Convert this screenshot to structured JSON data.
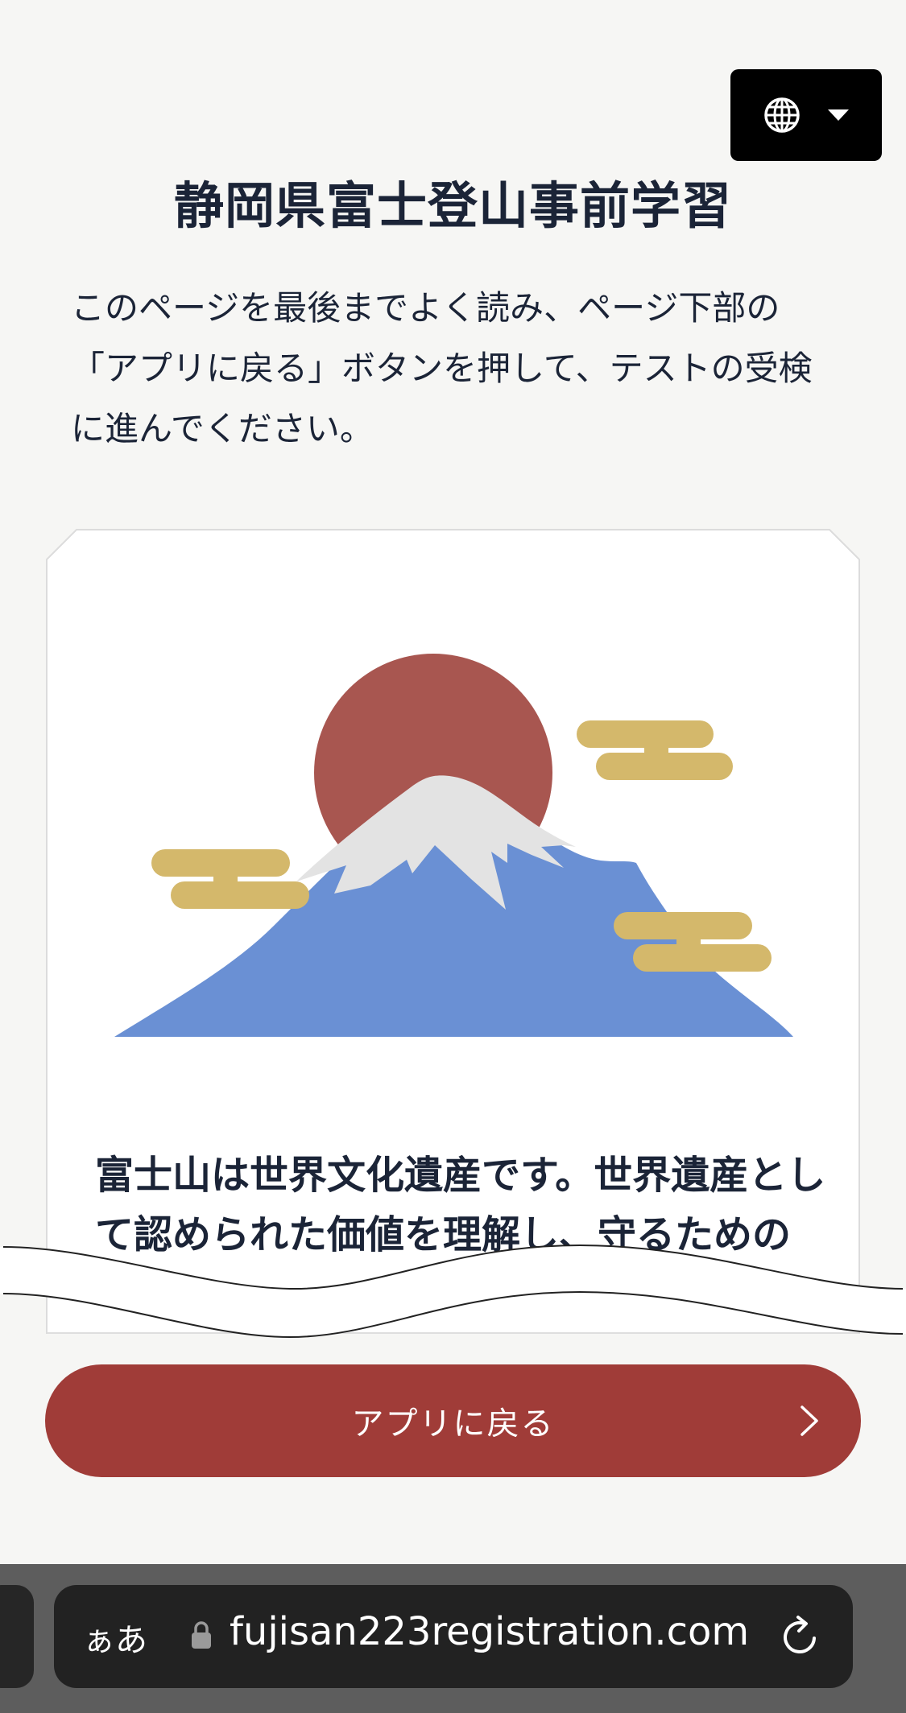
{
  "language_button": {
    "icon": "globe-icon",
    "dropdown_icon": "caret-down-icon"
  },
  "page": {
    "title": "静岡県富士登山事前学習",
    "intro": "このページを最後までよく読み、ページ下部の「アプリに戻る」ボタンを押して、テストの受検に進んでください。"
  },
  "card": {
    "illustration": "mount-fuji-sunrise-illustration",
    "text": "富士山は世界文化遺産です。世界遺産として認められた価値を理解し、守るための"
  },
  "return_button": {
    "label": "アプリに戻る",
    "icon": "chevron-right-icon"
  },
  "browser": {
    "text_size_label": "ぁあ",
    "url": "fujisan223registration.com",
    "lock_icon": "lock-icon",
    "reload_icon": "reload-icon"
  },
  "colors": {
    "background": "#f6f6f4",
    "title_text": "#1b2437",
    "button": "#a03c38",
    "sun": "#a85650",
    "mountain": "#6a90d4",
    "snow": "#e3e3e3",
    "cloud": "#d4b86b",
    "browser_bar": "#5d5d5d"
  }
}
